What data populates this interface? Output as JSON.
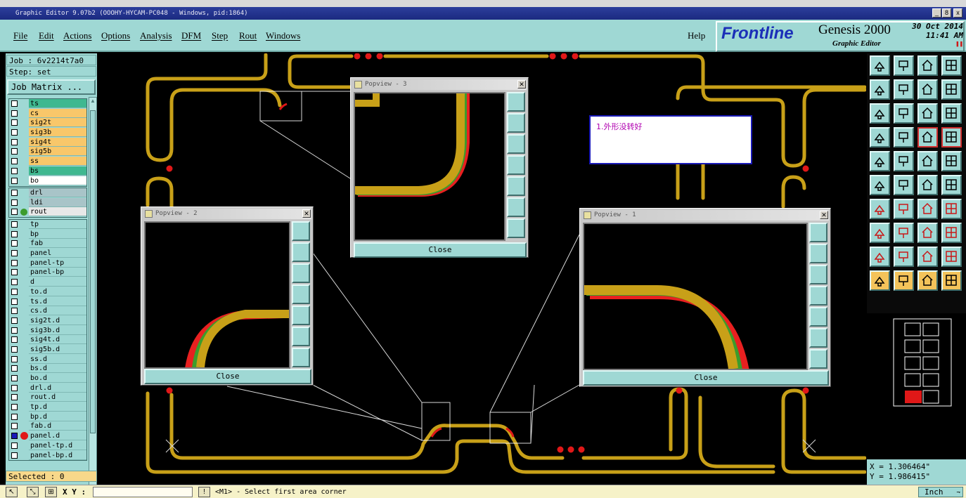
{
  "window": {
    "title": "Graphic Editor 9.07b2 (OOOHY-HYCAM-PC048 - Windows, pid:1864)",
    "controls": [
      "_",
      "8",
      "x"
    ]
  },
  "menu": {
    "items": [
      "File",
      "Edit",
      "Actions",
      "Options",
      "Analysis",
      "DFM",
      "Step",
      "Rout",
      "Windows"
    ],
    "help": "Help"
  },
  "brand": {
    "logo": "Frontline",
    "product": "Genesis 2000",
    "subtitle": "Graphic Editor",
    "date": "30 Oct 2014",
    "time": "11:41 AM"
  },
  "job": {
    "job_line": "Job : 6v2214t7a0",
    "step_line": "Step: set",
    "job_matrix_label": "Job Matrix ..."
  },
  "layers": {
    "group1": [
      {
        "name": "ts",
        "color": "#3fb890"
      },
      {
        "name": "cs",
        "color": "#f8c76a"
      },
      {
        "name": "sig2t",
        "color": "#f8c76a"
      },
      {
        "name": "sig3b",
        "color": "#f8c76a"
      },
      {
        "name": "sig4t",
        "color": "#f8c76a"
      },
      {
        "name": "sig5b",
        "color": "#f8c76a"
      },
      {
        "name": "ss",
        "color": "#f8c76a"
      },
      {
        "name": "bs",
        "color": "#3fb890"
      },
      {
        "name": "bo",
        "color": "#ffffff"
      }
    ],
    "group2": [
      {
        "name": "drl",
        "color": "#a8c4c8"
      },
      {
        "name": "ldi",
        "color": "#a8c4c8"
      },
      {
        "name": "rout",
        "color": "#e8e8e8"
      }
    ],
    "group3": [
      {
        "name": "tp"
      },
      {
        "name": "bp"
      },
      {
        "name": "fab"
      },
      {
        "name": "panel"
      },
      {
        "name": "panel-tp"
      },
      {
        "name": "panel-bp"
      },
      {
        "name": "d"
      },
      {
        "name": "to.d"
      },
      {
        "name": "ts.d"
      },
      {
        "name": "cs.d"
      },
      {
        "name": "sig2t.d"
      },
      {
        "name": "sig3b.d"
      },
      {
        "name": "sig4t.d"
      },
      {
        "name": "sig5b.d"
      },
      {
        "name": "ss.d"
      },
      {
        "name": "bs.d"
      },
      {
        "name": "bo.d"
      },
      {
        "name": "drl.d"
      },
      {
        "name": "rout.d"
      },
      {
        "name": "tp.d"
      },
      {
        "name": "bp.d"
      },
      {
        "name": "fab.d"
      },
      {
        "name": "panel.d"
      },
      {
        "name": "panel-tp.d"
      },
      {
        "name": "panel-bp.d"
      }
    ]
  },
  "selected": "Selected : 0",
  "status": {
    "xy_label": "X Y :",
    "xy_value": "",
    "prompt": "<M1> - Select first area corner",
    "units": "Inch"
  },
  "coords": {
    "x": "X = 1.306464\"",
    "y": "Y = 1.986415\""
  },
  "popviews": {
    "pv3": {
      "title": "Popview - 3",
      "close": "Close"
    },
    "pv2": {
      "title": "Popview - 2",
      "close": "Close"
    },
    "pv1": {
      "title": "Popview - 1",
      "close": "Close"
    }
  },
  "note": "1.外形没转好",
  "colors": {
    "trace": "#c8a018",
    "trace_green": "#3c9c2c",
    "trace_red": "#e82020",
    "pad_red": "#e01818",
    "panel_bg": "#9fd8d4"
  }
}
